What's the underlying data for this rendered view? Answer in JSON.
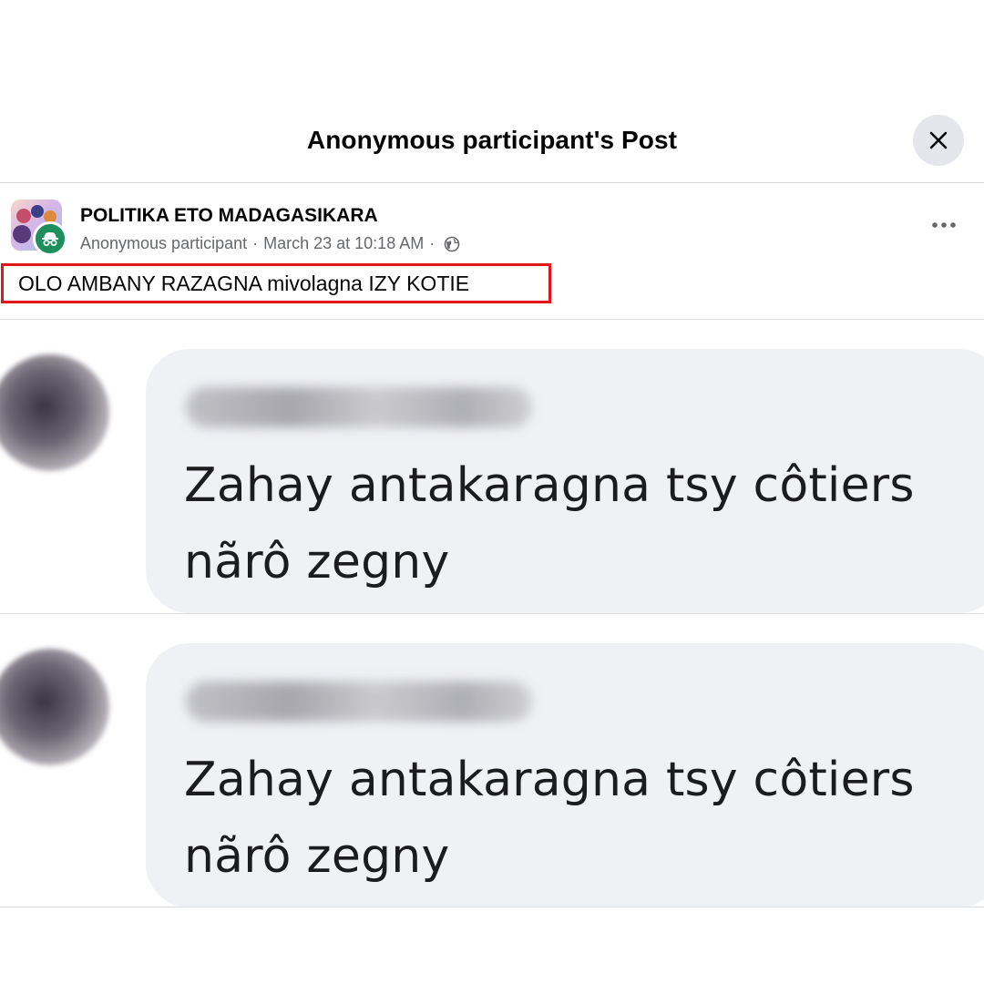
{
  "modal": {
    "title": "Anonymous participant's Post",
    "close_icon": "close-icon"
  },
  "post": {
    "group_name": "POLITIKA ETO MADAGASIKARA",
    "author": "Anonymous participant",
    "separator": "·",
    "timestamp": "March 23 at 10:18 AM",
    "privacy_icon": "globe-icon",
    "more_icon": "more-options-icon",
    "text": "OLO AMBANY RAZAGNA mivolagna IZY KOTIE",
    "highlight_color": "#e3141a"
  },
  "comments": [
    {
      "text": "Zahay antakaragna tsy côtiers nãrô zegny"
    },
    {
      "text": "Zahay antakaragna tsy côtiers nãrô zegny"
    }
  ],
  "colors": {
    "anon_badge": "#1e8e5c",
    "bubble": "#f0f1f5",
    "meta_text": "#65676b"
  }
}
